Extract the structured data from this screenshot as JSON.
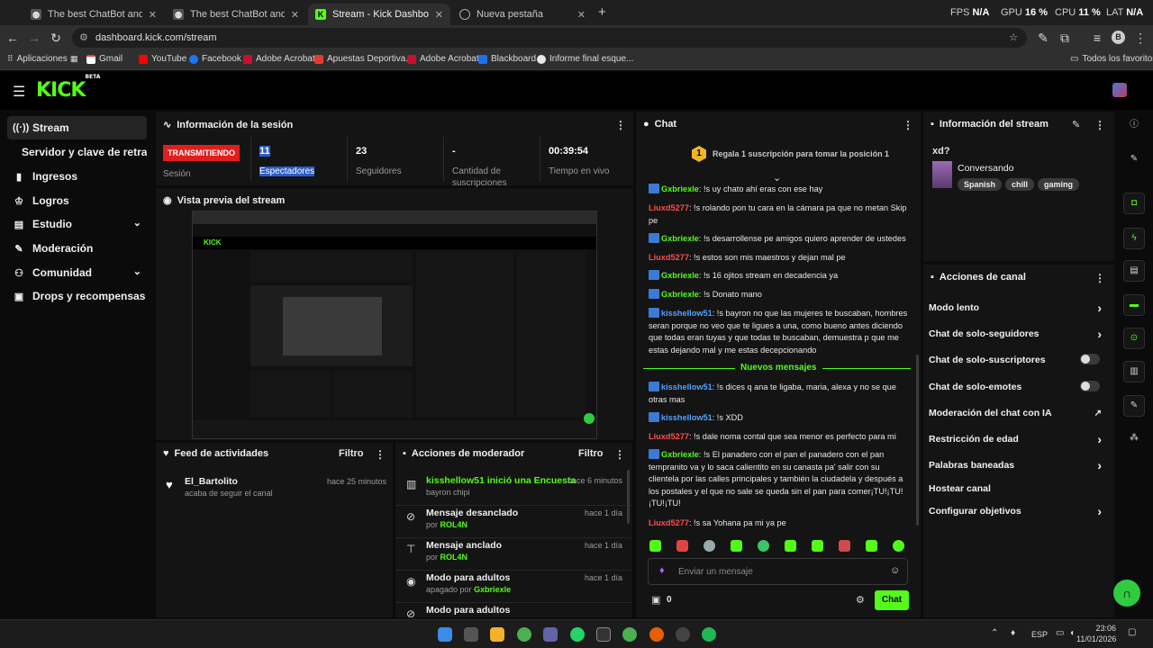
{
  "browser": {
    "tabs": [
      {
        "title": "The best ChatBot and Widgets",
        "active": false
      },
      {
        "title": "The best ChatBot and Widgets",
        "active": false
      },
      {
        "title": "Stream - Kick Dashboard",
        "active": true
      },
      {
        "title": "Nueva pestaña",
        "active": false
      }
    ],
    "new_tab": "+",
    "perf": {
      "fps_label": "FPS",
      "fps": "N/A",
      "gpu_label": "GPU",
      "gpu": "16 %",
      "cpu_label": "CPU",
      "cpu": "11 %",
      "lat_label": "LAT",
      "lat": "N/A"
    },
    "url": "dashboard.kick.com/stream",
    "profile": "B",
    "bookmarks": [
      "Aplicaciones",
      "Gmail",
      "YouTube",
      "Facebook",
      "Adobe Acrobat",
      "Apuestas Deportiva...",
      "Adobe Acrobat",
      "Blackboard",
      "Informe final esque..."
    ],
    "all_bookmarks": "Todos los favoritos"
  },
  "app": {
    "logo": "KICK",
    "logo_sup": "BETA"
  },
  "sidebar": {
    "items": [
      {
        "label": "Stream",
        "icon": "broadcast-icon"
      },
      {
        "label": "Servidor y clave de retransmisión",
        "icon": ""
      },
      {
        "label": "Ingresos",
        "icon": "bar-chart-icon"
      },
      {
        "label": "Logros",
        "icon": "trophy-icon"
      },
      {
        "label": "Estudio",
        "icon": "layout-icon"
      },
      {
        "label": "Moderación",
        "icon": "wrench-icon"
      },
      {
        "label": "Comunidad",
        "icon": "people-icon"
      },
      {
        "label": "Drops y recompensas",
        "icon": "gift-icon"
      }
    ]
  },
  "session": {
    "title": "Información de la sesión",
    "status_badge": "TRANSMITIENDO",
    "status_label": "Sesión",
    "viewers": "11",
    "viewers_label": "Espectadores",
    "followers": "23",
    "followers_label": "Seguidores",
    "subs": "-",
    "subs_label": "Cantidad de suscripciones",
    "uptime": "00:39:54",
    "uptime_label": "Tiempo en vivo"
  },
  "preview": {
    "title": "Vista previa del stream"
  },
  "feed": {
    "title": "Feed de actividades",
    "filter": "Filtro",
    "items": [
      {
        "user": "El_Bartolito",
        "action": "acaba de seguir el canal",
        "time": "hace 25 minutos"
      }
    ]
  },
  "modactions": {
    "title": "Acciones de moderador",
    "filter": "Filtro",
    "items": [
      {
        "title": "kisshellow51 inició una Encuesta",
        "sub": "bayron chipi",
        "by": "",
        "time": "hace 6 minutos"
      },
      {
        "title": "Mensaje desanclado",
        "sub": "por",
        "by": "ROL4N",
        "time": "hace 1 día"
      },
      {
        "title": "Mensaje anclado",
        "sub": "por",
        "by": "ROL4N",
        "time": "hace 1 día"
      },
      {
        "title": "Modo para adultos",
        "sub": "apagado por",
        "by": "Gxbriexle",
        "time": "hace 1 día"
      },
      {
        "title": "Modo para adultos",
        "sub": "",
        "by": "",
        "time": ""
      }
    ]
  },
  "chat": {
    "title": "Chat",
    "gift_rank": "1",
    "gift_banner": "Regala 1 suscripción para tomar la posición 1",
    "new_messages": "Nuevos mensajes",
    "messages": [
      {
        "user": "Gxbriexle",
        "text": "!s uy chato ahí eras con ese hay",
        "color": "#53fc18",
        "badge": true
      },
      {
        "user": "Liuxd5277",
        "text": "!s rolando pon tu cara en la cámara pa que no metan Skip pe",
        "color": "#ff4d4d",
        "badge": false
      },
      {
        "user": "Gxbriexle",
        "text": "!s desarrollense pe amigos quiero aprender de ustedes",
        "color": "#53fc18",
        "badge": true
      },
      {
        "user": "Liuxd5277",
        "text": "!s estos son mis maestros y dejan mal pe",
        "color": "#ff4d4d",
        "badge": false
      },
      {
        "user": "Gxbriexle",
        "text": "!s 16 ojitos stream en decadencia ya",
        "color": "#53fc18",
        "badge": true
      },
      {
        "user": "Gxbriexle",
        "text": "!s Donato mano",
        "color": "#53fc18",
        "badge": true
      },
      {
        "user": "kisshellow51",
        "text": "!s bayron no que las mujeres te buscaban, hombres seran porque no veo que te ligues a una, como bueno antes diciendo que todas eran tuyas y que todas te buscaban, demuestra p que me estas dejando mal y me estas decepcionando",
        "color": "#4ea3ff",
        "badge": true
      },
      {
        "user": "kisshellow51",
        "text": "!s dices q ana te ligaba, maria, alexa y no se que otras mas",
        "color": "#4ea3ff",
        "badge": true
      },
      {
        "user": "kisshellow51",
        "text": "!s XDD",
        "color": "#4ea3ff",
        "badge": true
      },
      {
        "user": "Liuxd5277",
        "text": "!s dale noma contal que sea menor es perfecto para mi",
        "color": "#ff4d4d",
        "badge": false
      },
      {
        "user": "Gxbriexle",
        "text": "!s El panadero con el pan el panadero con el pan tempranito va y lo saca calientito en su canasta pa' salir con su clientela por las calles principales y también la ciudadela y después a los postales y el que no sale se queda sin el pan para comer¡TU!¡TU! ¡TU!¡TU!",
        "color": "#53fc18",
        "badge": true
      },
      {
        "user": "Liuxd5277",
        "text": "!s sa Yohana pa mi ya pe",
        "color": "#ff4d4d",
        "badge": false
      }
    ],
    "input_placeholder": "Enviar un mensaje",
    "points": "0",
    "send": "Chat"
  },
  "streaminfo": {
    "title": "Información del stream",
    "stream_title": "xd?",
    "category": "Conversando",
    "tags": [
      "Spanish",
      "chill",
      "gaming"
    ]
  },
  "channel": {
    "title": "Acciones de canal",
    "actions": [
      {
        "label": "Modo lento",
        "kind": "chevron"
      },
      {
        "label": "Chat de solo-seguidores",
        "kind": "chevron"
      },
      {
        "label": "Chat de solo-suscriptores",
        "kind": "toggle"
      },
      {
        "label": "Chat de solo-emotes",
        "kind": "toggle"
      },
      {
        "label": "Moderación del chat con IA",
        "kind": "external"
      },
      {
        "label": "Restricción de edad",
        "kind": "chevron"
      },
      {
        "label": "Palabras baneadas",
        "kind": "chevron"
      },
      {
        "label": "Hostear canal",
        "kind": "none"
      },
      {
        "label": "Configurar objetivos",
        "kind": "chevron"
      }
    ]
  },
  "taskbar": {
    "lang": "ESP",
    "time": "23:06",
    "date": "11/01/2026"
  },
  "colors": {
    "accent": "#53fc18",
    "live": "#e01e1e",
    "panel": "#141414"
  }
}
